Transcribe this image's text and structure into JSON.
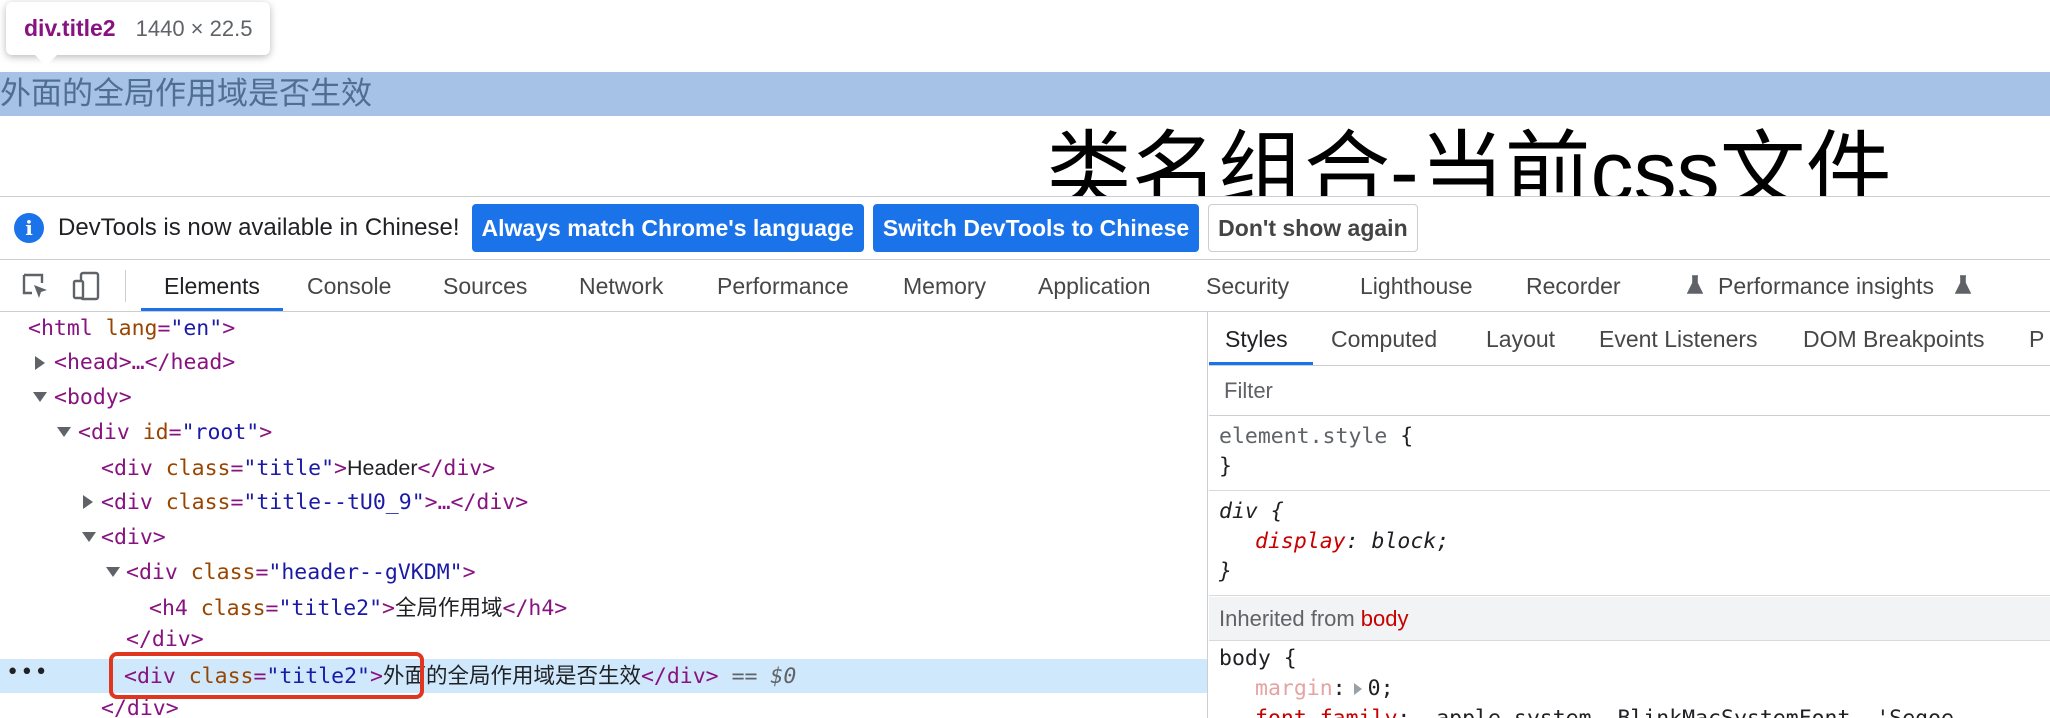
{
  "page": {
    "highlighted_text": "外面的全局作用域是否生效",
    "heading": "类名组合-当前css文件"
  },
  "tooltip": {
    "selector": "div.title2",
    "size": "1440 × 22.5"
  },
  "infobar": {
    "icon": "info-icon",
    "message": "DevTools is now available in Chinese!",
    "match_language": "Always match Chrome's language",
    "switch_chinese": "Switch DevTools to Chinese",
    "dont_show": "Don't show again"
  },
  "main_tabs": [
    "Elements",
    "Console",
    "Sources",
    "Network",
    "Performance",
    "Memory",
    "Application",
    "Security",
    "Lighthouse",
    "Recorder",
    "Performance insights"
  ],
  "toolbar_icons": [
    "inspect-element-icon",
    "device-toggle-icon",
    "flask-icon"
  ],
  "dom": {
    "html_open": "<html",
    "lang_attr": "lang",
    "lang_val": "\"en\"",
    "close_bracket": ">",
    "head_collapsed": "<head>…</head>",
    "body_open": "<body>",
    "div_open": "<div",
    "id_attr": "id",
    "id_root": "\"root\"",
    "class_attr": "class",
    "title_val": "\"title\"",
    "header_text": "Header",
    "div_close": "</div>",
    "title_hash_val": "\"title--tU0_9\"",
    "ellipsis_close": ">…</div>",
    "div_plain": "<div>",
    "header_hash_val": "\"header--gVKDM\"",
    "h4_open": "<h4",
    "title2_val": "\"title2\"",
    "h4_text": "全局作用域",
    "h4_close": "</h4>",
    "selected_text": "外面的全局作用域是否生效",
    "eq_dollar": "== $0",
    "row_dots": "•••"
  },
  "styles": {
    "tabs": [
      "Styles",
      "Computed",
      "Layout",
      "Event Listeners",
      "DOM Breakpoints",
      "P"
    ],
    "filter_placeholder": "Filter",
    "element_style": "element.style",
    "open_brace": "{",
    "close_brace": "}",
    "div_selector": "div",
    "display_prop": "display",
    "display_val": "block;",
    "inherited_label": "Inherited from",
    "inherited_element": "body",
    "body_selector": "body",
    "margin_prop": "margin",
    "margin_val": "0;",
    "font_family_prop": "font-family",
    "font_family_val": "-apple-system, BlinkMacSystemFont, 'Segoe"
  },
  "colors": {
    "accent": "#1a73e8",
    "page_highlight": "#a6c2e6",
    "selected_row": "#cfe8fc",
    "annotation_box": "#e0351f",
    "tag": "#881280",
    "attr_name": "#994500",
    "attr_value": "#1a1aa6"
  }
}
